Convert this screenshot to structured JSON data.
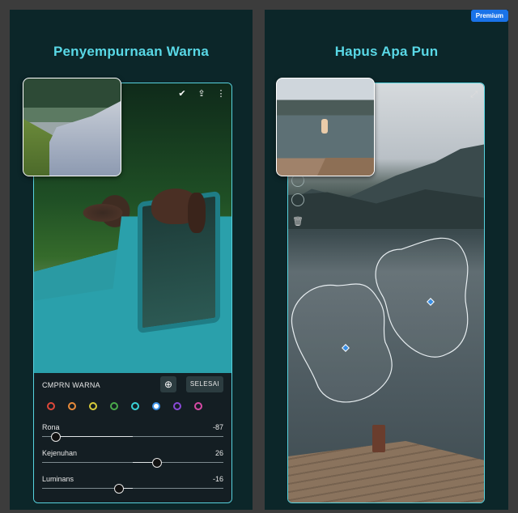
{
  "left_panel": {
    "title": "Penyempurnaan Warna",
    "top_icons": [
      "check-circle-icon",
      "share-icon",
      "more-icon"
    ],
    "controls": {
      "header": "CMPRN WARNA",
      "done_label": "SELESAI",
      "swatches": [
        {
          "name": "red",
          "color": "#e0483a",
          "selected": false
        },
        {
          "name": "orange",
          "color": "#e98b3a",
          "selected": false
        },
        {
          "name": "yellow",
          "color": "#d8cc3a",
          "selected": false
        },
        {
          "name": "green",
          "color": "#4aab4a",
          "selected": false
        },
        {
          "name": "aqua",
          "color": "#3ad3d8",
          "selected": false
        },
        {
          "name": "blue",
          "color": "#3a8fe5",
          "selected": true
        },
        {
          "name": "purple",
          "color": "#8a4ad8",
          "selected": false
        },
        {
          "name": "magenta",
          "color": "#d84aa6",
          "selected": false
        }
      ],
      "sliders": [
        {
          "label": "Rona",
          "value": "-87",
          "level": 0.07
        },
        {
          "label": "Kejenuhan",
          "value": "26",
          "level": 0.63
        },
        {
          "label": "Luminans",
          "value": "-16",
          "level": 0.42
        }
      ]
    }
  },
  "right_panel": {
    "title": "Hapus Apa Pun",
    "badge": "Premium"
  }
}
